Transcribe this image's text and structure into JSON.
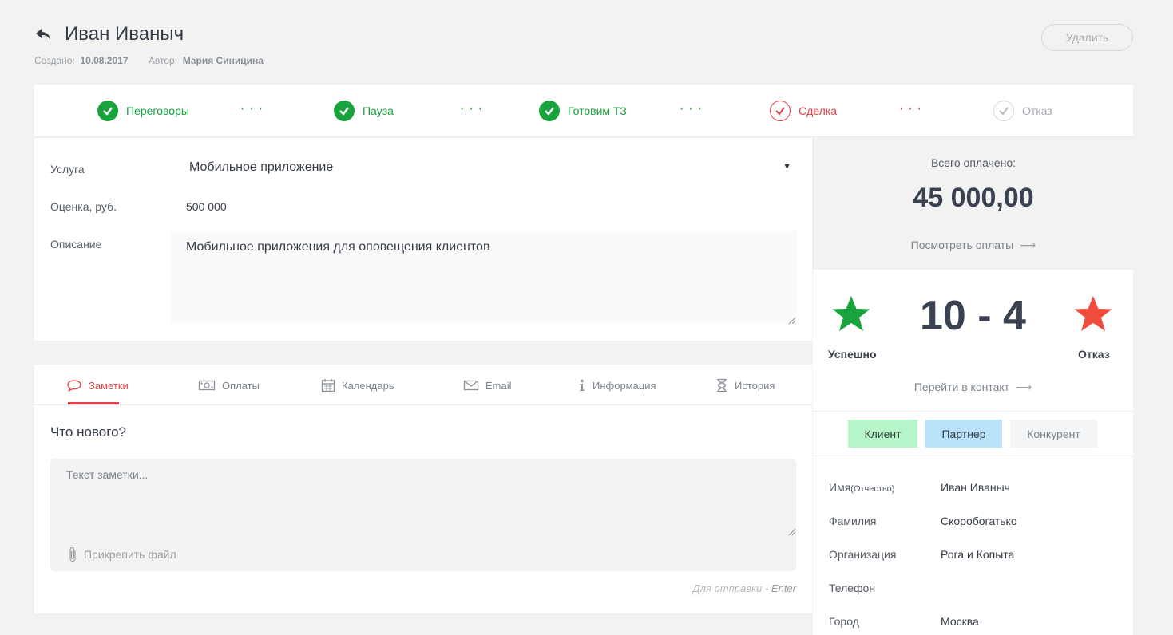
{
  "header": {
    "title": "Иван Иваныч",
    "created_label": "Создано:",
    "created_value": "10.08.2017",
    "author_label": "Автор:",
    "author_value": "Мария Синицина",
    "delete_label": "Удалить",
    "back_icon": "back-arrow-icon"
  },
  "pipeline": {
    "stages": [
      {
        "label": "Переговоры",
        "state": "done"
      },
      {
        "label": "Пауза",
        "state": "done"
      },
      {
        "label": "Готовим ТЗ",
        "state": "done"
      },
      {
        "label": "Сделка",
        "state": "active"
      },
      {
        "label": "Отказ",
        "state": "todo"
      }
    ]
  },
  "deal": {
    "service_label": "Услуга",
    "service_value": "Мобильное приложение",
    "estimate_label": "Оценка, руб.",
    "estimate_value": "500 000",
    "description_label": "Описание",
    "description_value": "Мобильное приложения для оповещения клиентов"
  },
  "payments": {
    "total_label": "Всего оплачено:",
    "total_value": "45 000,00",
    "view_link": "Посмотреть оплаты"
  },
  "score": {
    "value": "10 - 4",
    "success_label": "Успешно",
    "fail_label": "Отказ",
    "contact_link": "Перейти в контакт",
    "success_color": "#19a33d",
    "fail_color": "#f14b3b"
  },
  "roles": {
    "client": "Клиент",
    "partner": "Партнер",
    "competitor": "Конкурент"
  },
  "contact": {
    "name_label": "Имя",
    "name_sub": "(Отчество)",
    "name_value": "Иван Иваныч",
    "surname_label": "Фамилия",
    "surname_value": "Скоробогатько",
    "org_label": "Организация",
    "org_value": "Рога и Копыта",
    "phone_label": "Телефон",
    "phone_value": "",
    "city_label": "Город",
    "city_value": "Москва"
  },
  "tabs": [
    {
      "label": "Заметки",
      "icon": "speech-bubble-icon"
    },
    {
      "label": "Оплаты",
      "icon": "money-icon"
    },
    {
      "label": "Календарь",
      "icon": "calendar-icon"
    },
    {
      "label": "Email",
      "icon": "envelope-icon"
    },
    {
      "label": "Информация",
      "icon": "info-icon"
    },
    {
      "label": "История",
      "icon": "hourglass-icon"
    }
  ],
  "notes": {
    "title": "Что нового?",
    "placeholder": "Текст заметки...",
    "attach_label": "Прикрепить файл",
    "send_hint": "Для отправки - ",
    "send_key": "Enter"
  }
}
